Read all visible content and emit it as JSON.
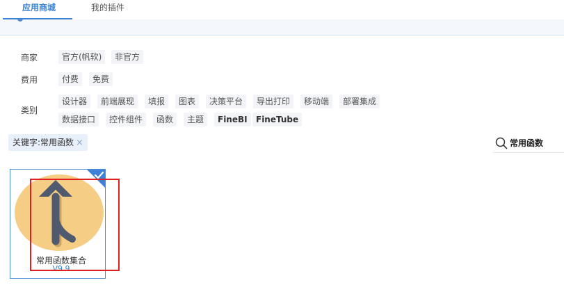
{
  "tabs": [
    {
      "label": "应用商城",
      "active": true
    },
    {
      "label": "我的插件",
      "active": false
    }
  ],
  "filters": {
    "vendor": {
      "label": "商家",
      "options": [
        "官方(帆软)",
        "非官方"
      ]
    },
    "fee": {
      "label": "费用",
      "options": [
        "付费",
        "免费"
      ]
    },
    "category": {
      "label": "类别",
      "options_row1": [
        "设计器",
        "前端展现",
        "填报",
        "图表",
        "决策平台",
        "导出打印",
        "移动端",
        "部署集成"
      ],
      "options_row2": [
        "数据接口",
        "控件组件",
        "函数",
        "主题",
        "FineBI",
        "FineTube"
      ]
    }
  },
  "keyword_tag": {
    "label": "关键字:常用函数",
    "close": "×"
  },
  "search": {
    "value": "常用函数",
    "icon": "search-icon"
  },
  "plugin_card": {
    "name": "常用函数集合",
    "version": "V9.9",
    "selected": true,
    "icon": "merge-arrow-icon"
  },
  "colors": {
    "accent": "#3d82d6",
    "icon_bg": "#f6cd85",
    "arrow": "#4f5a6e",
    "highlight": "#e02020"
  }
}
